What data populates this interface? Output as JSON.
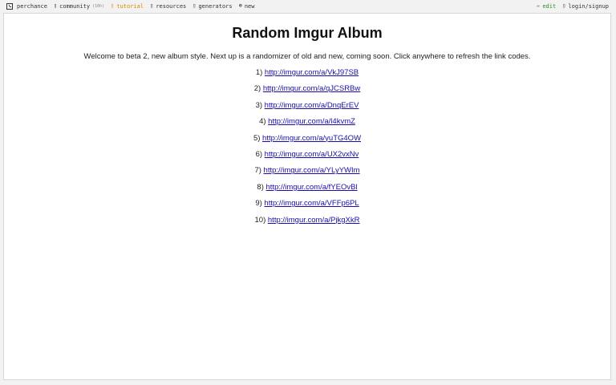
{
  "nav": {
    "site_name": "perchance",
    "items": [
      {
        "label": "community",
        "icon": "chat-icon",
        "badge": "(10h)"
      },
      {
        "label": "tutorial",
        "icon": "book-icon"
      },
      {
        "label": "resources",
        "icon": "folder-icon"
      },
      {
        "label": "generators",
        "icon": "list-icon"
      },
      {
        "label": "new",
        "icon": "plus-circle-icon"
      }
    ],
    "right_items": [
      {
        "label": "edit",
        "icon": "pencil-icon"
      },
      {
        "label": "login/signup",
        "icon": "user-icon"
      }
    ],
    "colors": {
      "tutorial": "#d28a00",
      "edit": "#2e8b2e",
      "link": "#1a0dab"
    }
  },
  "page": {
    "title": "Random Imgur Album",
    "intro": "Welcome to beta 2, new album style. Next up is a randomizer of old and new, coming soon. Click anywhere to refresh the link codes.",
    "links": [
      {
        "index": "1)",
        "url": "http://imgur.com/a/VkJ97SB"
      },
      {
        "index": "2)",
        "url": "http://imgur.com/a/qJCSRBw"
      },
      {
        "index": "3)",
        "url": "http://imgur.com/a/DnqErEV"
      },
      {
        "index": "4)",
        "url": "http://imgur.com/a/l4kvmZ"
      },
      {
        "index": "5)",
        "url": "http://imgur.com/a/yuTG4OW"
      },
      {
        "index": "6)",
        "url": "http://imgur.com/a/UX2vxNv"
      },
      {
        "index": "7)",
        "url": "http://imgur.com/a/YLyYWIm"
      },
      {
        "index": "8)",
        "url": "http://imgur.com/a/fYEOvBl"
      },
      {
        "index": "9)",
        "url": "http://imgur.com/a/VFFp6PL"
      },
      {
        "index": "10)",
        "url": "http://imgur.com/a/PjkgXkR"
      }
    ]
  }
}
